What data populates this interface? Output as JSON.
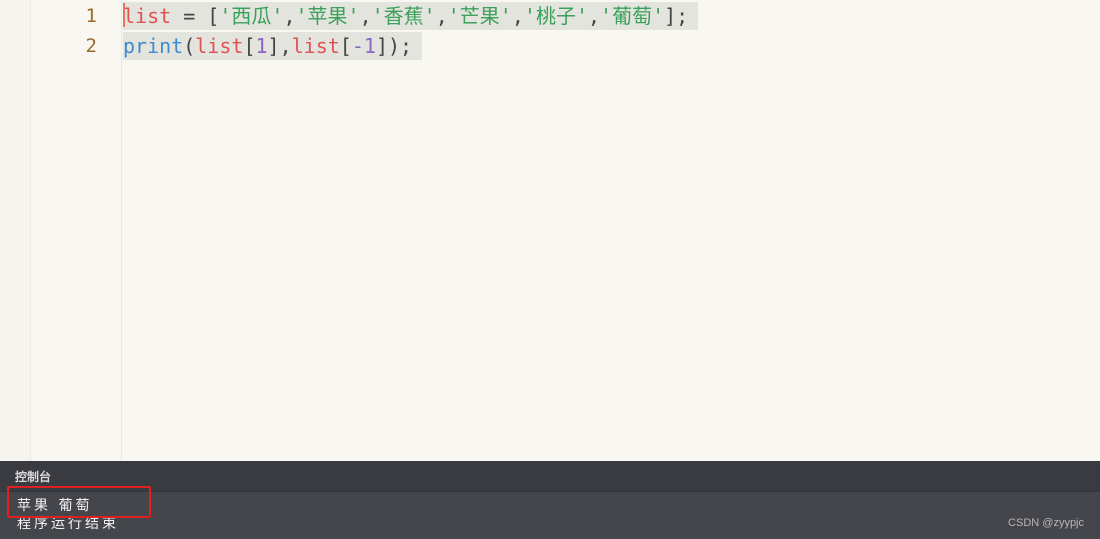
{
  "editor": {
    "line_numbers": [
      "1",
      "2"
    ],
    "lines": [
      {
        "tokens": [
          {
            "text": "list",
            "kind": "var"
          },
          {
            "text": " = [",
            "kind": "punc"
          },
          {
            "text": "'西瓜'",
            "kind": "str"
          },
          {
            "text": ",",
            "kind": "punc"
          },
          {
            "text": "'苹果'",
            "kind": "str"
          },
          {
            "text": ",",
            "kind": "punc"
          },
          {
            "text": "'香蕉'",
            "kind": "str"
          },
          {
            "text": ",",
            "kind": "punc"
          },
          {
            "text": "'芒果'",
            "kind": "str"
          },
          {
            "text": ",",
            "kind": "punc"
          },
          {
            "text": "'桃子'",
            "kind": "str"
          },
          {
            "text": ",",
            "kind": "punc"
          },
          {
            "text": "'葡萄'",
            "kind": "str"
          },
          {
            "text": "];",
            "kind": "punc"
          }
        ]
      },
      {
        "tokens": [
          {
            "text": "print",
            "kind": "fn"
          },
          {
            "text": "(",
            "kind": "punc"
          },
          {
            "text": "list",
            "kind": "var"
          },
          {
            "text": "[",
            "kind": "punc"
          },
          {
            "text": "1",
            "kind": "num"
          },
          {
            "text": "],",
            "kind": "punc"
          },
          {
            "text": "list",
            "kind": "var"
          },
          {
            "text": "[",
            "kind": "punc"
          },
          {
            "text": "-1",
            "kind": "num"
          },
          {
            "text": "]);",
            "kind": "punc"
          }
        ]
      }
    ]
  },
  "console": {
    "title": "控制台",
    "output": [
      "苹果 葡萄",
      "程序运行结束"
    ]
  },
  "watermark": "CSDN @zyypjc",
  "colors": {
    "editor_bg": "#f8f7f2",
    "console_bg": "#45464b",
    "annotation": "#e02020"
  }
}
